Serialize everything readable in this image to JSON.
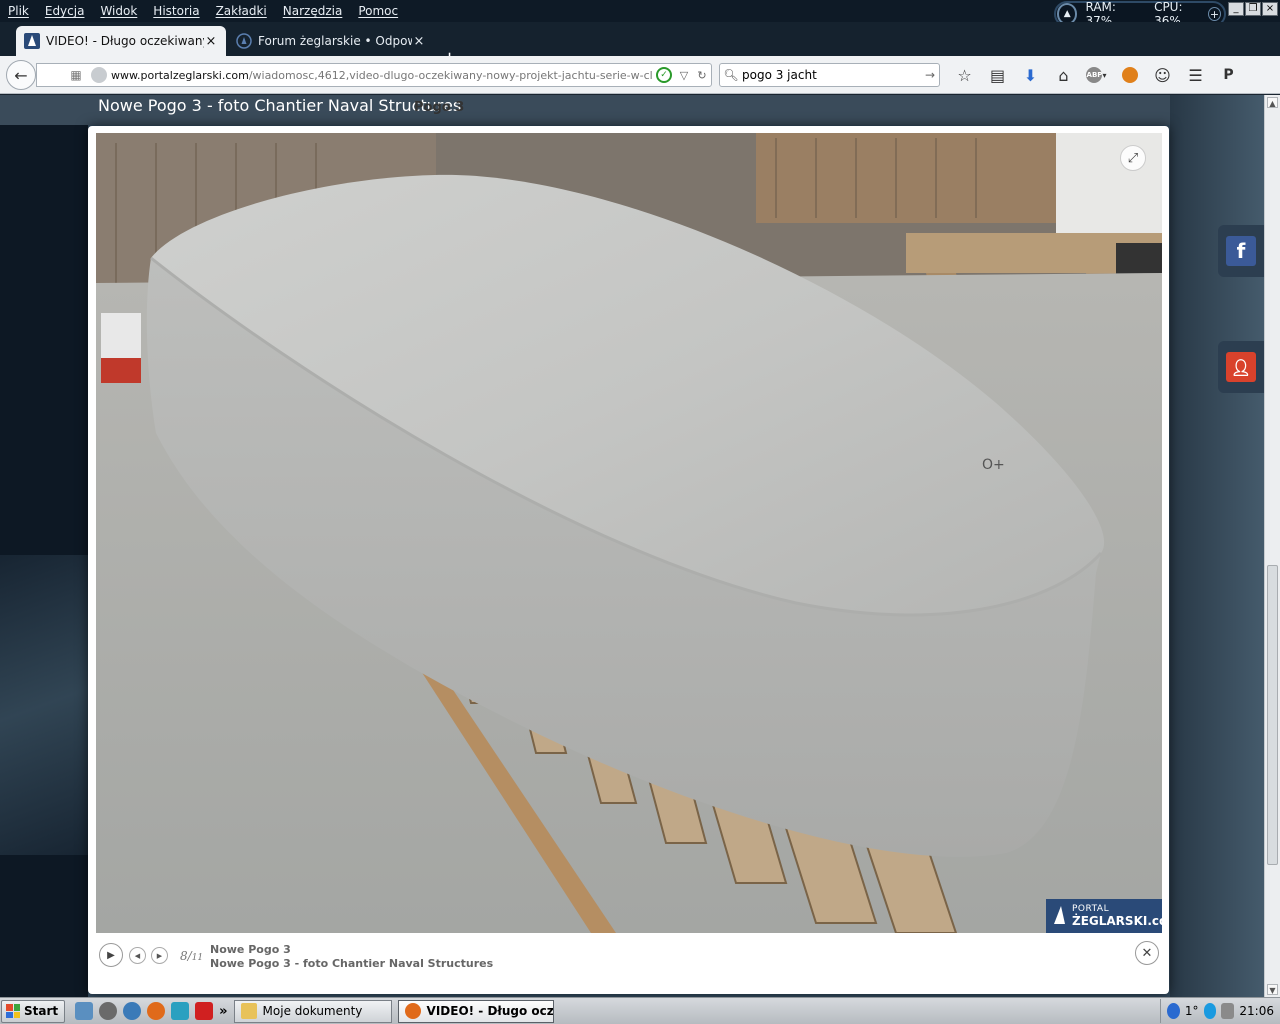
{
  "menubar": {
    "items": [
      "Plik",
      "Edycja",
      "Widok",
      "Historia",
      "Zakładki",
      "Narzędzia",
      "Pomoc"
    ],
    "sysmon": {
      "ram": "RAM: 37%",
      "cpu": "CPU: 36%"
    }
  },
  "tabs": [
    {
      "title": "VIDEO! - Długo oczekiwany n...",
      "close": "×",
      "active": true
    },
    {
      "title": "Forum żeglarskie • Odpowiedz",
      "close": "×",
      "active": false
    }
  ],
  "newtab": "+",
  "navbar": {
    "url_domain": "www.portalzeglarski.com",
    "url_path": "/wiadomosc,4612,video-dlugo-oczekiwany-nowy-projekt-jachtu-serie-w-class-mini-czyli-pog",
    "search_value": "pogo 3 jacht",
    "icons": [
      "star-icon",
      "reader-icon",
      "download-icon",
      "home-icon",
      "adblock-icon",
      "extension-icon",
      "emoji-icon",
      "menu-icon",
      "pocket-icon"
    ]
  },
  "page": {
    "bg_title": "Nowe Pogo 3 - foto Chantier Naval Structures",
    "bg_subtitle": "Pogo 3"
  },
  "lightbox": {
    "counter_current": "8",
    "counter_total": "11",
    "caption_title": "Nowe Pogo 3",
    "caption_desc": "Nowe Pogo 3 - foto Chantier Naval Structures",
    "watermark_top": "PORTAL",
    "watermark_bottom": "ŻEGLARSKI.com",
    "hull_mark": "O+"
  },
  "taskbar": {
    "start": "Start",
    "overflow": "»",
    "items": [
      {
        "label": "Moje dokumenty",
        "active": false
      },
      {
        "label": "VIDEO! - Długo oczeki...",
        "active": true
      }
    ],
    "temp": "1°",
    "time": "21:06"
  },
  "colors": {
    "chrome_dark": "#0e1a26",
    "accent_blue": "#2a4a78",
    "facebook": "#3b5a98",
    "user_red": "#d9422c"
  }
}
